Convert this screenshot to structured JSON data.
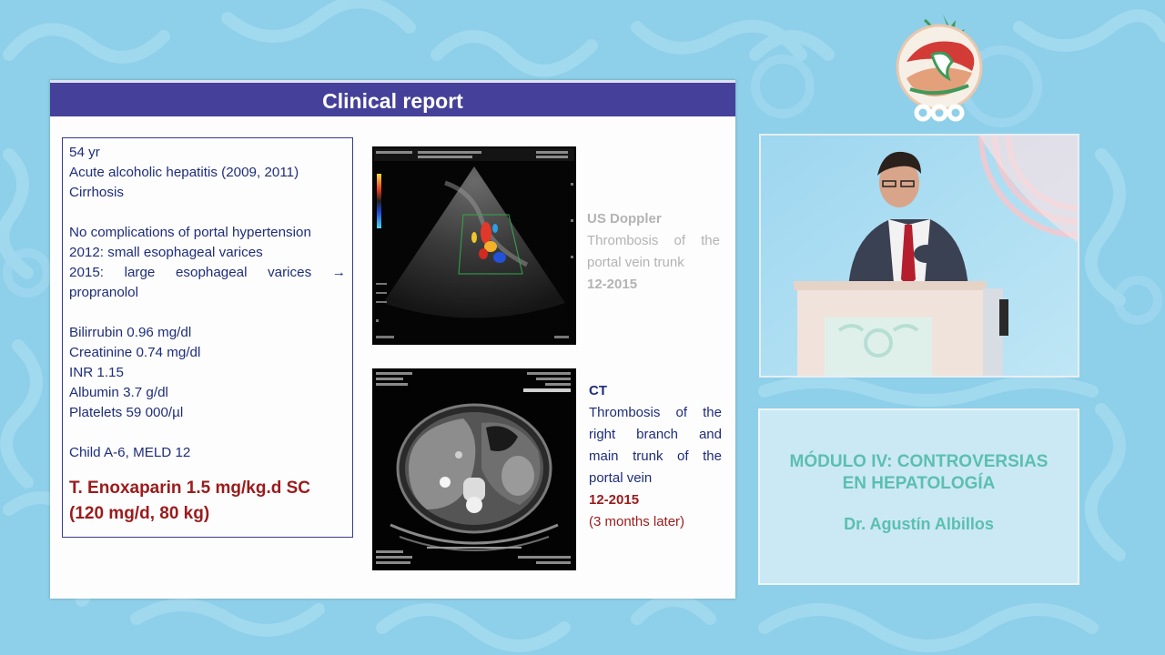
{
  "slide": {
    "title": "Clinical report",
    "patient": {
      "age": "54 yr",
      "history_1": "Acute alcoholic hepatitis (2009, 2011)",
      "history_2": "Cirrhosis",
      "complications": "No complications of portal hypertension",
      "varices_2012": "2012: small esophageal varices",
      "varices_2015_words": [
        "2015:",
        "large",
        "esophageal",
        "varices",
        "→"
      ],
      "varices_2015_cont": "propranolol",
      "labs": [
        "Bilirrubin 0.96 mg/dl",
        "Creatinine 0.74 mg/dl",
        "INR 1.15",
        "Albumin 3.7 g/dl",
        "Platelets 59 000/µl"
      ],
      "score": "Child A-6, MELD 12",
      "treatment_line1": "T. Enoxaparin 1.5 mg/kg.d SC",
      "treatment_line2": "(120 mg/d, 80 kg)"
    },
    "us_caption": {
      "title": "US Doppler",
      "line1_words": [
        "Thrombosis",
        "of",
        "the"
      ],
      "line2": "portal vein trunk",
      "date": "12-2015"
    },
    "ct_caption": {
      "title": "CT",
      "line1_words": [
        "Thrombosis",
        "of",
        "the"
      ],
      "line2_words": [
        "right",
        "branch",
        "and"
      ],
      "line3_words": [
        "main",
        "trunk",
        "of",
        "the"
      ],
      "line4": "portal vein",
      "date": "12-2015",
      "note": "(3 months later)"
    }
  },
  "module": {
    "title_line1": "MÓDULO IV: CONTROVERSIAS",
    "title_line2": "EN HEPATOLOGÍA",
    "speaker": "Dr. Agustín Albillos"
  },
  "colors": {
    "background": "#8ecfe9",
    "title_bar": "#45419a",
    "body_text": "#1f2d7a",
    "highlight_red": "#9b1b1b",
    "module_text": "#5bbfb1"
  }
}
